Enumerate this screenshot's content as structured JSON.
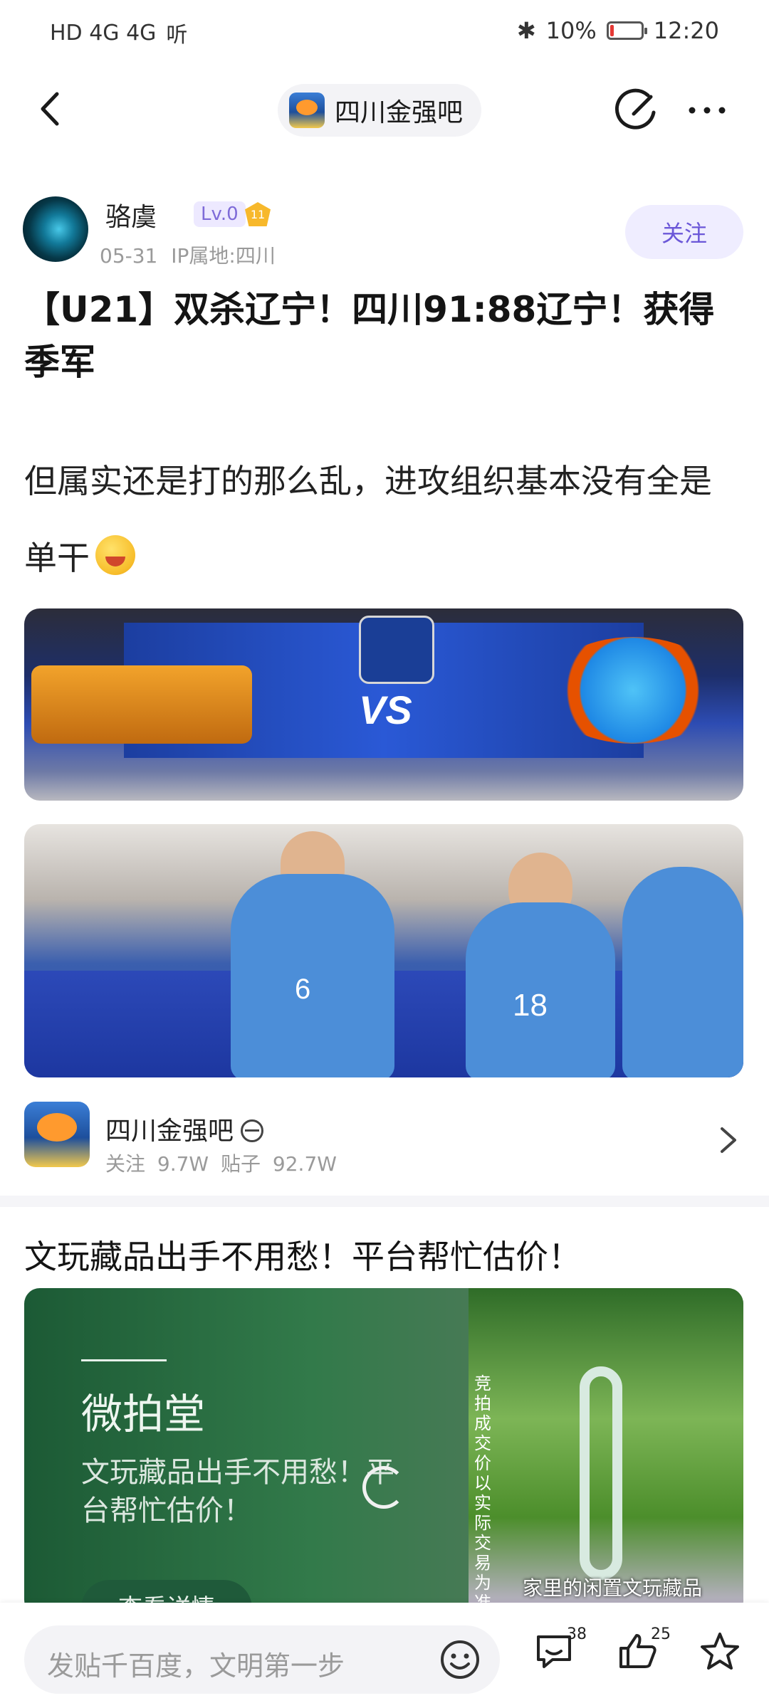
{
  "status": {
    "left_text": "HD 4G 4G",
    "extra": "听",
    "bluetooth": "✱",
    "battery": "10%",
    "time": "12:20"
  },
  "nav": {
    "forum_name": "四川金强吧"
  },
  "post": {
    "author": "骆虞",
    "level": "Lv.0",
    "medal": "11",
    "date": "05-31",
    "ip": "IP属地:四川",
    "follow": "关注",
    "title": "【U21】双杀辽宁！四川91:88辽宁！获得季军",
    "body": "但属实还是打的那么乱，进攻组织基本没有全是单干"
  },
  "images": {
    "vs_text": "VS",
    "player_numbers": [
      "6",
      "18"
    ]
  },
  "forum_card": {
    "name": "四川金强吧",
    "stats": "关注 9.7W   贴子 92.7W"
  },
  "ad": {
    "headline": "文玩藏品出手不用愁！平台帮忙估价！",
    "brand": "微拍堂",
    "subtitle": "文玩藏品出手不用愁！平台帮忙估价！",
    "vertical_note": "竞拍成交价以实际交易为准",
    "caption": "家里的闲置文玩藏品",
    "button": "查看详情"
  },
  "bottom": {
    "placeholder": "发贴千百度，文明第一步",
    "comments": "38",
    "likes": "25"
  }
}
